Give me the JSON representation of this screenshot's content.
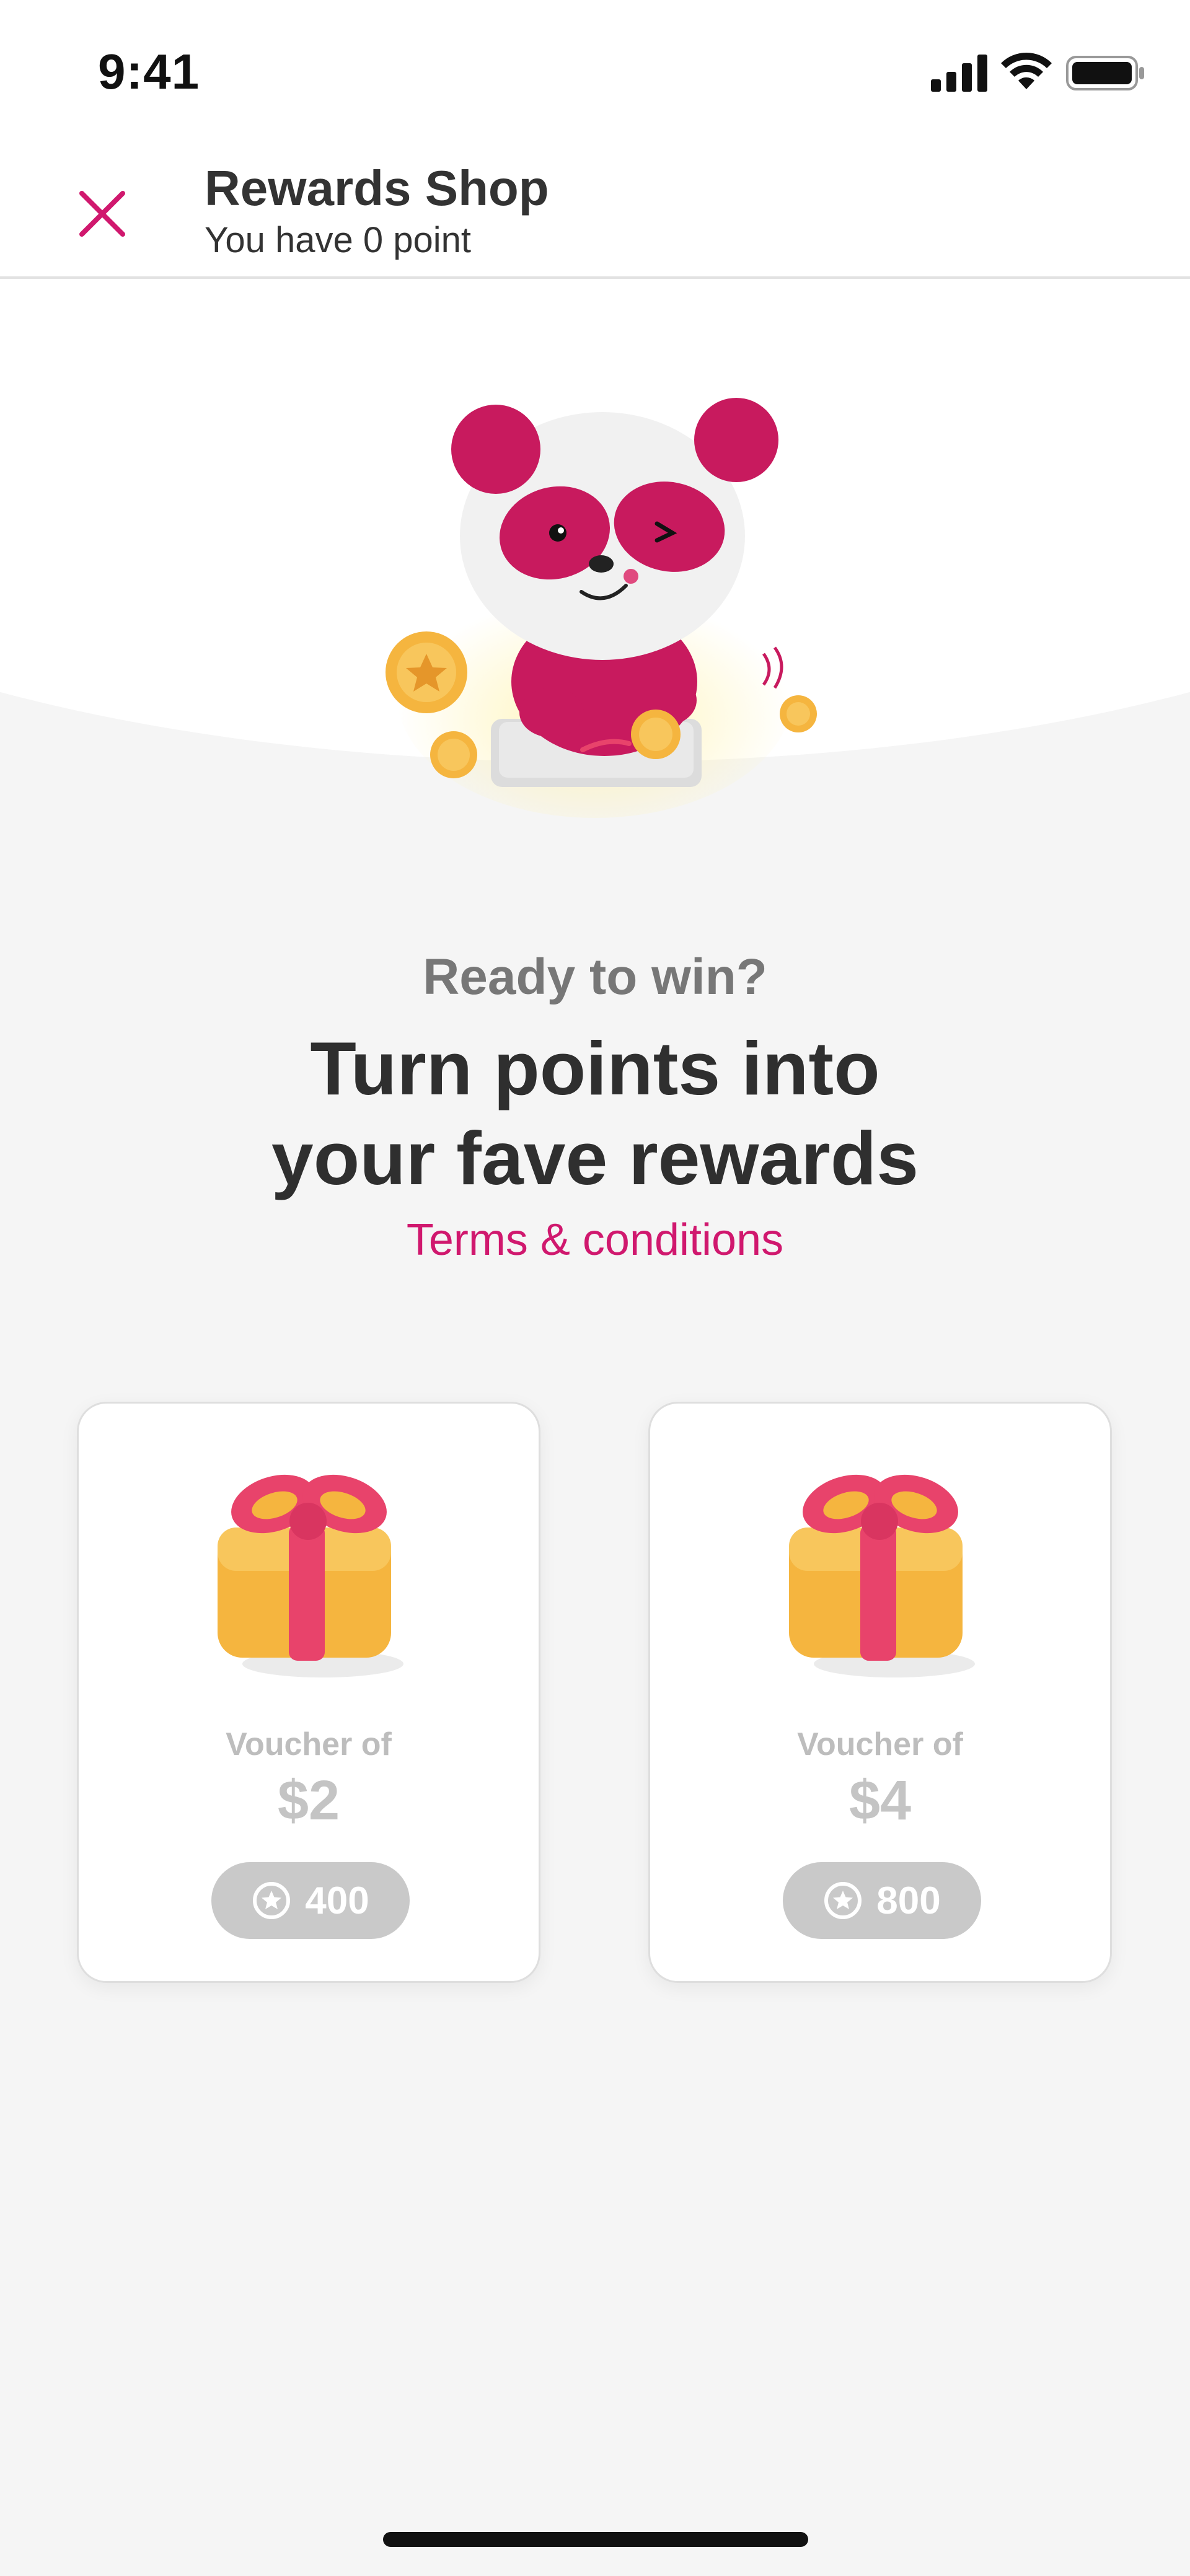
{
  "status_bar": {
    "time": "9:41"
  },
  "header": {
    "title": "Rewards Shop",
    "subtitle": "You have 0 point"
  },
  "hero": {
    "eyebrow": "Ready to win?",
    "headline": "Turn points into your fave rewards",
    "terms_link": "Terms & conditions"
  },
  "vouchers": [
    {
      "label": "Voucher of",
      "value": "$2",
      "points": "400"
    },
    {
      "label": "Voucher of",
      "value": "$4",
      "points": "800"
    }
  ],
  "colors": {
    "brand_pink": "#d0186e",
    "gift_box": "#f5b53f",
    "gift_ribbon": "#e8436b",
    "pill_bg": "#c9c9c9"
  },
  "icons": [
    "close-icon",
    "signal-icon",
    "wifi-icon",
    "battery-icon",
    "panda-mascot",
    "gift-icon",
    "star-coin-icon"
  ]
}
